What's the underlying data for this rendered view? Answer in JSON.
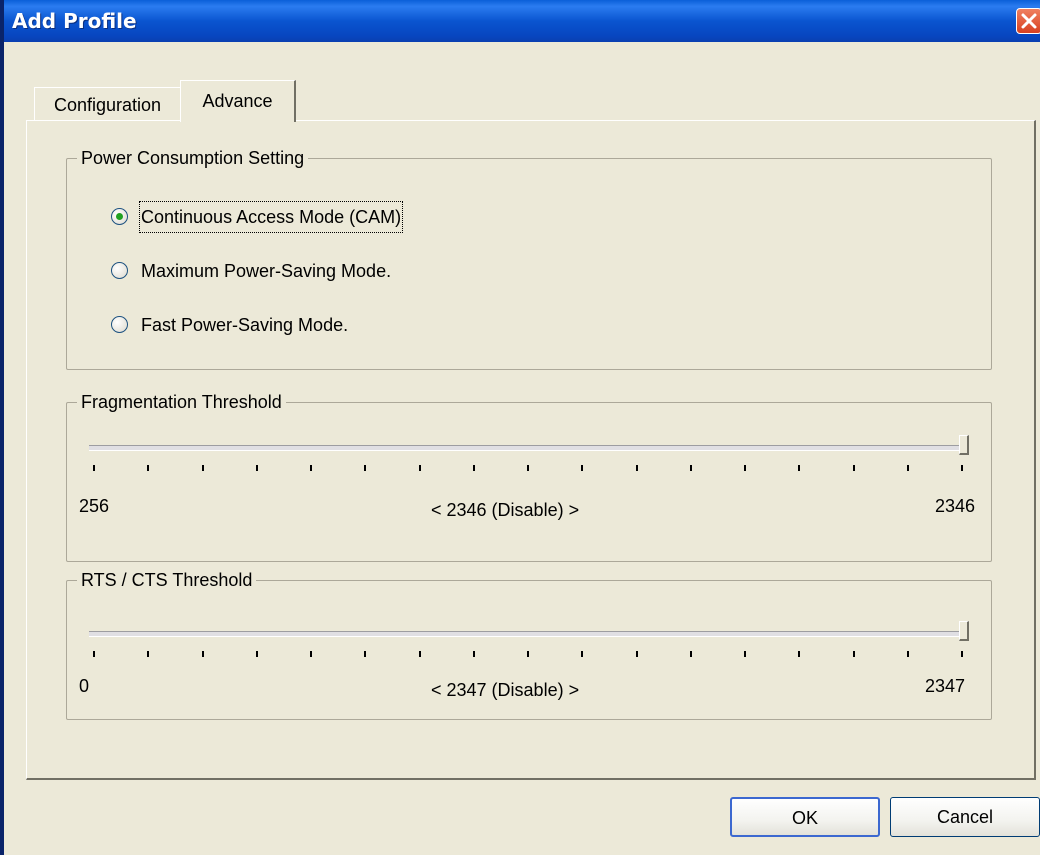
{
  "window": {
    "title": "Add Profile"
  },
  "tabs": [
    {
      "label": "Configuration",
      "active": false
    },
    {
      "label": "Advance",
      "active": true
    }
  ],
  "power": {
    "title": "Power Consumption Setting",
    "options": [
      {
        "label": "Continuous Access Mode (CAM)",
        "selected": true
      },
      {
        "label": "Maximum Power-Saving Mode.",
        "selected": false
      },
      {
        "label": "Fast Power-Saving Mode.",
        "selected": false
      }
    ]
  },
  "fragmentation": {
    "title": "Fragmentation Threshold",
    "min": "256",
    "max": "2346",
    "current": "< 2346 (Disable) >",
    "value": 2346
  },
  "rts": {
    "title": "RTS / CTS Threshold",
    "min": "0",
    "max": "2347",
    "current": "< 2347 (Disable) >",
    "value": 2347
  },
  "buttons": {
    "ok": "OK",
    "cancel": "Cancel"
  },
  "colors": {
    "title_bar": "#0a55d0",
    "window_bg": "#ece9d8",
    "close_button": "#d84020",
    "radio_dot": "#21a121"
  }
}
